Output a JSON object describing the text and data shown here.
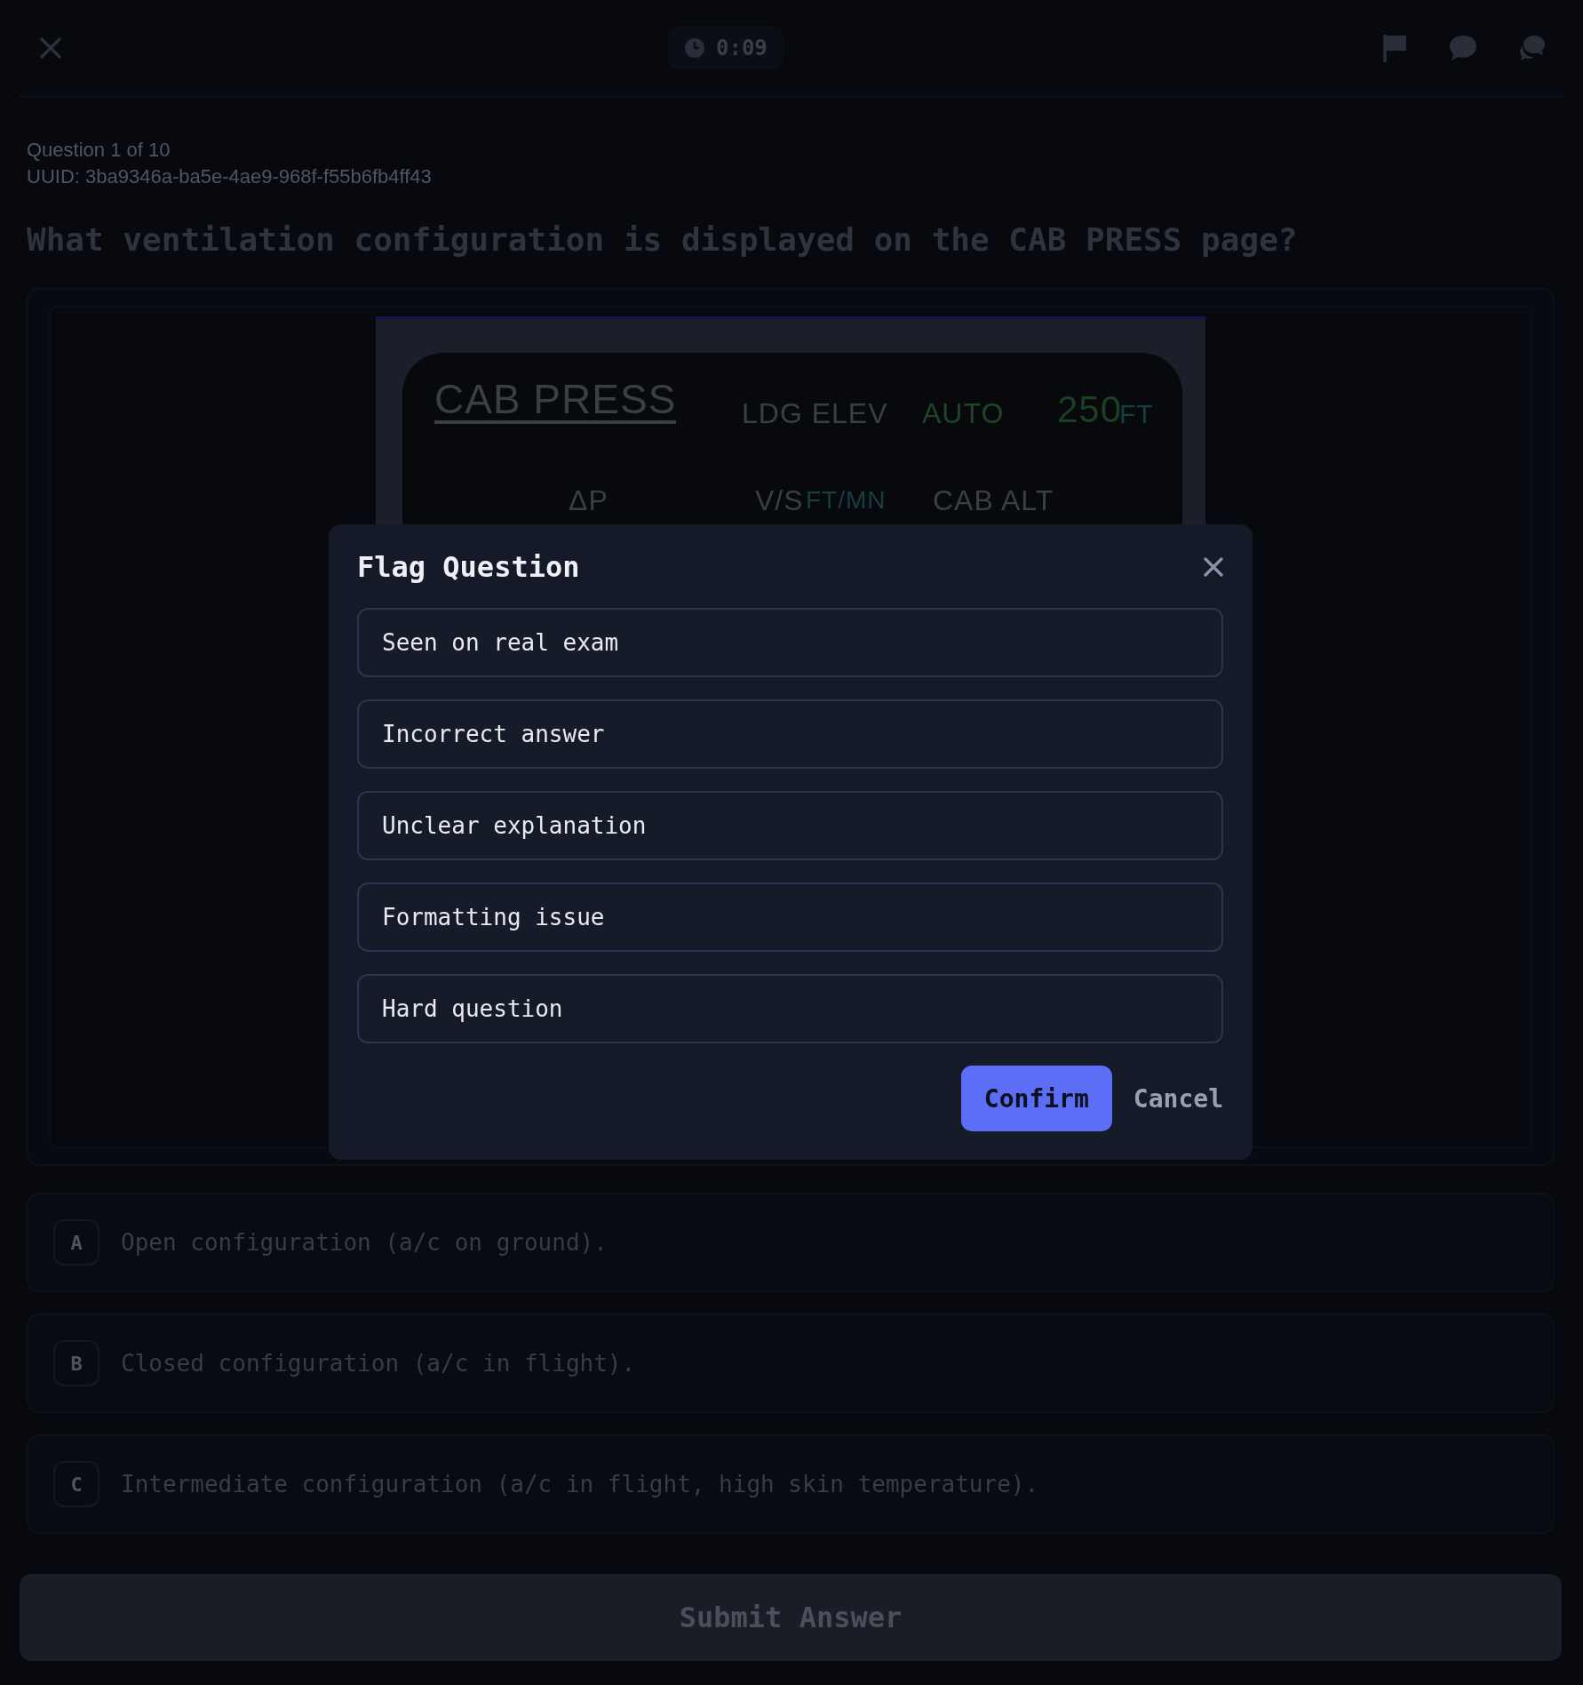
{
  "top_bar": {
    "timer": "0:09"
  },
  "question": {
    "counter": "Question 1 of 10",
    "uuid": "UUID: 3ba9346a-ba5e-4ae9-968f-f55b6fb4ff43",
    "text": "What ventilation configuration is displayed on the CAB PRESS page?"
  },
  "display": {
    "title": "CAB PRESS",
    "labels": [
      {
        "text": "LDG ELEV",
        "color": "#3b3e45"
      },
      {
        "text": "AUTO",
        "color": "#1f4426"
      },
      {
        "text": "250",
        "color": "#1d3f22"
      },
      {
        "text": "FT",
        "color": "#173e44"
      },
      {
        "text": "ΔP",
        "color": "#3b3e45"
      },
      {
        "text": "V/S",
        "color": "#3b3e45"
      },
      {
        "text": "FT/MN",
        "color": "#173e44"
      },
      {
        "text": "CAB ALT",
        "color": "#3b3e45"
      }
    ]
  },
  "answers": [
    {
      "letter": "A",
      "text": "Open configuration (a/c on ground)."
    },
    {
      "letter": "B",
      "text": "Closed configuration (a/c in flight)."
    },
    {
      "letter": "C",
      "text": "Intermediate configuration (a/c in flight, high skin temperature)."
    }
  ],
  "submit": {
    "label": "Submit Answer",
    "disabled": true
  },
  "dialog": {
    "title": "Flag Question",
    "options": [
      {
        "label": "Seen on real exam",
        "selected": false
      },
      {
        "label": "Incorrect answer",
        "selected": false
      },
      {
        "label": "Unclear explanation",
        "selected": false
      },
      {
        "label": "Formatting issue",
        "selected": false
      },
      {
        "label": "Hard question",
        "selected": false
      }
    ],
    "confirm": "Confirm",
    "cancel": "Cancel"
  }
}
